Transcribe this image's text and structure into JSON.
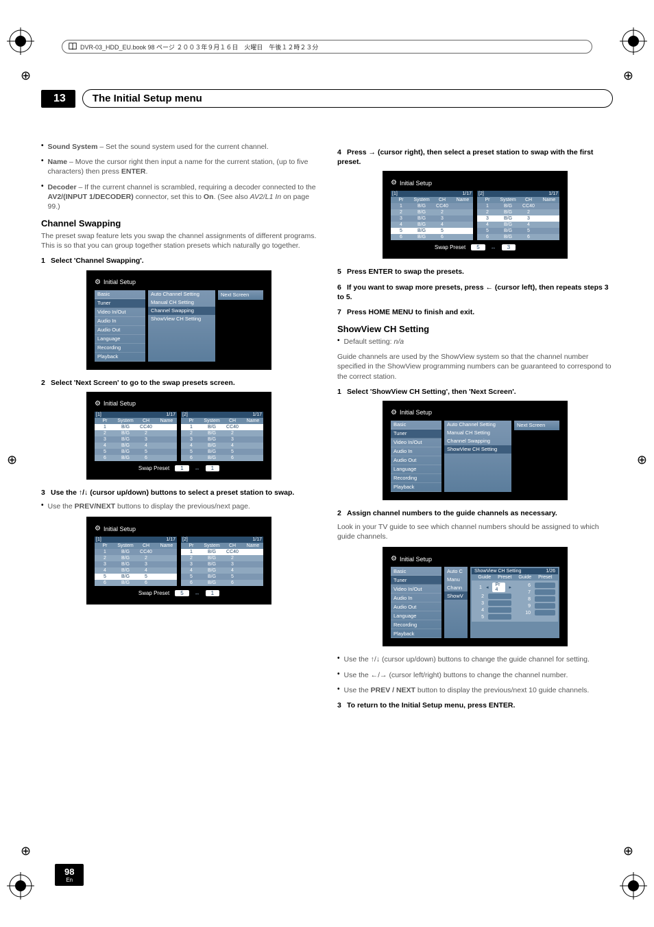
{
  "doc_header": "DVR-03_HDD_EU.book 98 ページ ２００３年９月１６日　火曜日　午後１２時２３分",
  "chapter_number": "13",
  "chapter_title": "The Initial Setup menu",
  "page_number": "98",
  "page_lang": "En",
  "left": {
    "bullets_top": [
      {
        "label": "Sound System",
        "text": " – Set the sound system used for the current channel."
      },
      {
        "label": "Name",
        "text": " – Move the cursor right then input a name for the current station, (up to five characters) then press ",
        "tail_bold": "ENTER",
        "tail": "."
      },
      {
        "label": "Decoder",
        "text": " – If the current channel is scrambled, requiring a decoder connected to the ",
        "mid_bold": "AV2/(INPUT 1/DECODER)",
        "text2": " connector, set this to ",
        "mid_bold2": "On",
        "text3": ". (See also ",
        "ital": "AV2/L1 In",
        "text4": " on page 99.)"
      }
    ],
    "h_channel_swapping": "Channel Swapping",
    "cs_intro": "The preset swap feature lets you swap the channel assignments of different programs. This is so that you can group together station presets which naturally go together.",
    "step1": "Select 'Channel Swapping'.",
    "panel1": {
      "title": "Initial Setup",
      "sidebar": [
        "Basic",
        "Tuner",
        "Video In/Out",
        "Audio In",
        "Audio Out",
        "Language",
        "Recording",
        "Playback"
      ],
      "menu": [
        "Auto Channel Setting",
        "Manual CH Setting",
        "Channel Swapping",
        "ShowView CH Setting"
      ],
      "next": "Next Screen"
    },
    "step2": "Select 'Next Screen' to go to the swap presets screen.",
    "panel2": {
      "title": "Initial Setup",
      "page_label_l": "[1]",
      "page_r_l": "1/17",
      "page_label_r": "[2]",
      "page_r_r": "1/17",
      "head": [
        "Pr",
        "System",
        "CH",
        "Name"
      ],
      "rows_l": [
        [
          "1",
          "B/G",
          "CC40",
          ""
        ],
        [
          "2",
          "B/G",
          "2",
          ""
        ],
        [
          "3",
          "B/G",
          "3",
          ""
        ],
        [
          "4",
          "B/G",
          "4",
          ""
        ],
        [
          "5",
          "B/G",
          "5",
          ""
        ],
        [
          "6",
          "B/G",
          "6",
          ""
        ]
      ],
      "rows_r": [
        [
          "1",
          "B/G",
          "CC40",
          ""
        ],
        [
          "2",
          "B/G",
          "2",
          ""
        ],
        [
          "3",
          "B/G",
          "3",
          ""
        ],
        [
          "4",
          "B/G",
          "4",
          ""
        ],
        [
          "5",
          "B/G",
          "5",
          ""
        ],
        [
          "6",
          "B/G",
          "6",
          ""
        ]
      ],
      "sel_l": 0,
      "sel_r": 0,
      "swap_label": "Swap Preset",
      "swap_l": "1",
      "swap_r": "1"
    },
    "step3_a": "Use the ",
    "step3_b": " (cursor up/down) buttons to select a preset station to swap.",
    "step3_sub_a": "Use the ",
    "step3_sub_b": "PREV/NEXT",
    "step3_sub_c": " buttons to display the previous/next page.",
    "panel3": {
      "title": "Initial Setup",
      "page_label_l": "[1]",
      "page_r_l": "1/17",
      "page_label_r": "[2]",
      "page_r_r": "1/17",
      "head": [
        "Pr",
        "System",
        "CH",
        "Name"
      ],
      "rows_l": [
        [
          "1",
          "B/G",
          "CC40",
          ""
        ],
        [
          "2",
          "B/G",
          "2",
          ""
        ],
        [
          "3",
          "B/G",
          "3",
          ""
        ],
        [
          "4",
          "B/G",
          "4",
          ""
        ],
        [
          "5",
          "B/G",
          "5",
          ""
        ],
        [
          "6",
          "B/G",
          "6",
          ""
        ]
      ],
      "rows_r": [
        [
          "1",
          "B/G",
          "CC40",
          ""
        ],
        [
          "2",
          "B/G",
          "2",
          ""
        ],
        [
          "3",
          "B/G",
          "3",
          ""
        ],
        [
          "4",
          "B/G",
          "4",
          ""
        ],
        [
          "5",
          "B/G",
          "5",
          ""
        ],
        [
          "6",
          "B/G",
          "6",
          ""
        ]
      ],
      "sel_l": 4,
      "sel_r": 0,
      "swap_label": "Swap Preset",
      "swap_l": "5",
      "swap_r": "1"
    }
  },
  "right": {
    "step4_a": "Press ",
    "step4_b": " (cursor right), then select a preset station to swap with the first preset.",
    "panel4": {
      "title": "Initial Setup",
      "page_label_l": "[1]",
      "page_r_l": "1/17",
      "page_label_r": "[2]",
      "page_r_r": "1/17",
      "head": [
        "Pr",
        "System",
        "CH",
        "Name"
      ],
      "rows_l": [
        [
          "1",
          "B/G",
          "CC40",
          ""
        ],
        [
          "2",
          "B/G",
          "2",
          ""
        ],
        [
          "3",
          "B/G",
          "3",
          ""
        ],
        [
          "4",
          "B/G",
          "4",
          ""
        ],
        [
          "5",
          "B/G",
          "5",
          ""
        ],
        [
          "6",
          "B/G",
          "6",
          ""
        ]
      ],
      "rows_r": [
        [
          "1",
          "B/G",
          "CC40",
          ""
        ],
        [
          "2",
          "B/G",
          "2",
          ""
        ],
        [
          "3",
          "B/G",
          "3",
          ""
        ],
        [
          "4",
          "B/G",
          "4",
          ""
        ],
        [
          "5",
          "B/G",
          "5",
          ""
        ],
        [
          "6",
          "B/G",
          "6",
          ""
        ]
      ],
      "sel_l": 4,
      "sel_r": 2,
      "swap_label": "Swap Preset",
      "swap_l": "5",
      "swap_r": "3"
    },
    "step5": "Press ENTER to swap the presets.",
    "step6_a": "If you want to swap more presets, press ",
    "step6_b": " (cursor left), then repeats steps 3 to 5.",
    "step7": "Press HOME MENU to finish and exit.",
    "h_showview": "ShowView CH Setting",
    "sv_default_a": "Default setting: ",
    "sv_default_b": "n/a",
    "sv_intro": "Guide channels are used by the ShowView system so that the channel number specified in the ShowView programming numbers can be guaranteed to correspond to the correct station.",
    "sv_step1": "Select 'ShowView CH Setting', then 'Next Screen'.",
    "panel5": {
      "title": "Initial Setup",
      "sidebar": [
        "Basic",
        "Tuner",
        "Video In/Out",
        "Audio In",
        "Audio Out",
        "Language",
        "Recording",
        "Playback"
      ],
      "menu": [
        "Auto Channel Setting",
        "Manual CH Setting",
        "Channel Swapping",
        "ShowView CH Setting"
      ],
      "next": "Next Screen"
    },
    "sv_step2": "Assign channel numbers to the guide channels as necessary.",
    "sv_step2_sub": "Look in your TV guide to see which channel numbers should be assigned to which guide channels.",
    "panel6": {
      "title": "Initial Setup",
      "sidebar": [
        "Basic",
        "Tuner",
        "Video In/Out",
        "Audio In",
        "Audio Out",
        "Language",
        "Recording",
        "Playback"
      ],
      "menu_short": [
        "Auto C",
        "Manu",
        "Chann",
        "ShowV"
      ],
      "sv_title": "ShowView CH Setting",
      "sv_page": "1/26",
      "sv_head": [
        "Guide",
        "Preset",
        "Guide",
        "Preset"
      ],
      "rows": [
        {
          "g": "1",
          "boxed": true,
          "label": "Pr 4"
        },
        {
          "g": "2"
        },
        {
          "g": "3"
        },
        {
          "g": "4"
        },
        {
          "g": "5"
        }
      ],
      "rows2": [
        {
          "g": "6"
        },
        {
          "g": "7"
        },
        {
          "g": "8"
        },
        {
          "g": "9"
        },
        {
          "g": "10"
        }
      ]
    },
    "sv_b1_a": "Use the ",
    "sv_b1_b": " (cursor up/down) buttons to change the guide channel for setting.",
    "sv_b2_a": "Use the ",
    "sv_b2_b": " (cursor left/right) buttons to change the channel number.",
    "sv_b3_a": "Use the ",
    "sv_b3_b": "PREV / NEXT",
    "sv_b3_c": " button to display the previous/next 10 guide channels.",
    "sv_step3": "To return to the Initial Setup menu, press ENTER."
  }
}
